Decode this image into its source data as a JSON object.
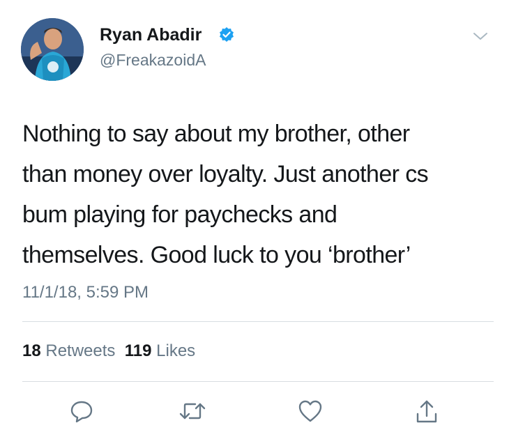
{
  "user": {
    "display_name": "Ryan Abadir",
    "handle": "@FreakazoidA",
    "verified": true,
    "avatar_icon": "avatar-photo"
  },
  "tweet": {
    "lines": [
      "Nothing to say about my brother, other",
      "than money over loyalty. Just another cs",
      "bum playing for paychecks and",
      "themselves. Good luck to you ‘brother’"
    ],
    "timestamp": "11/1/18, 5:59 PM"
  },
  "stats": {
    "retweets_count": "18",
    "retweets_label": "Retweets",
    "likes_count": "119",
    "likes_label": "Likes"
  },
  "actions": [
    "reply-icon",
    "retweet-icon",
    "like-icon",
    "share-icon"
  ],
  "colors": {
    "accent": "#1da1f2",
    "secondary_text": "#657786",
    "divider": "#d8dde1"
  }
}
